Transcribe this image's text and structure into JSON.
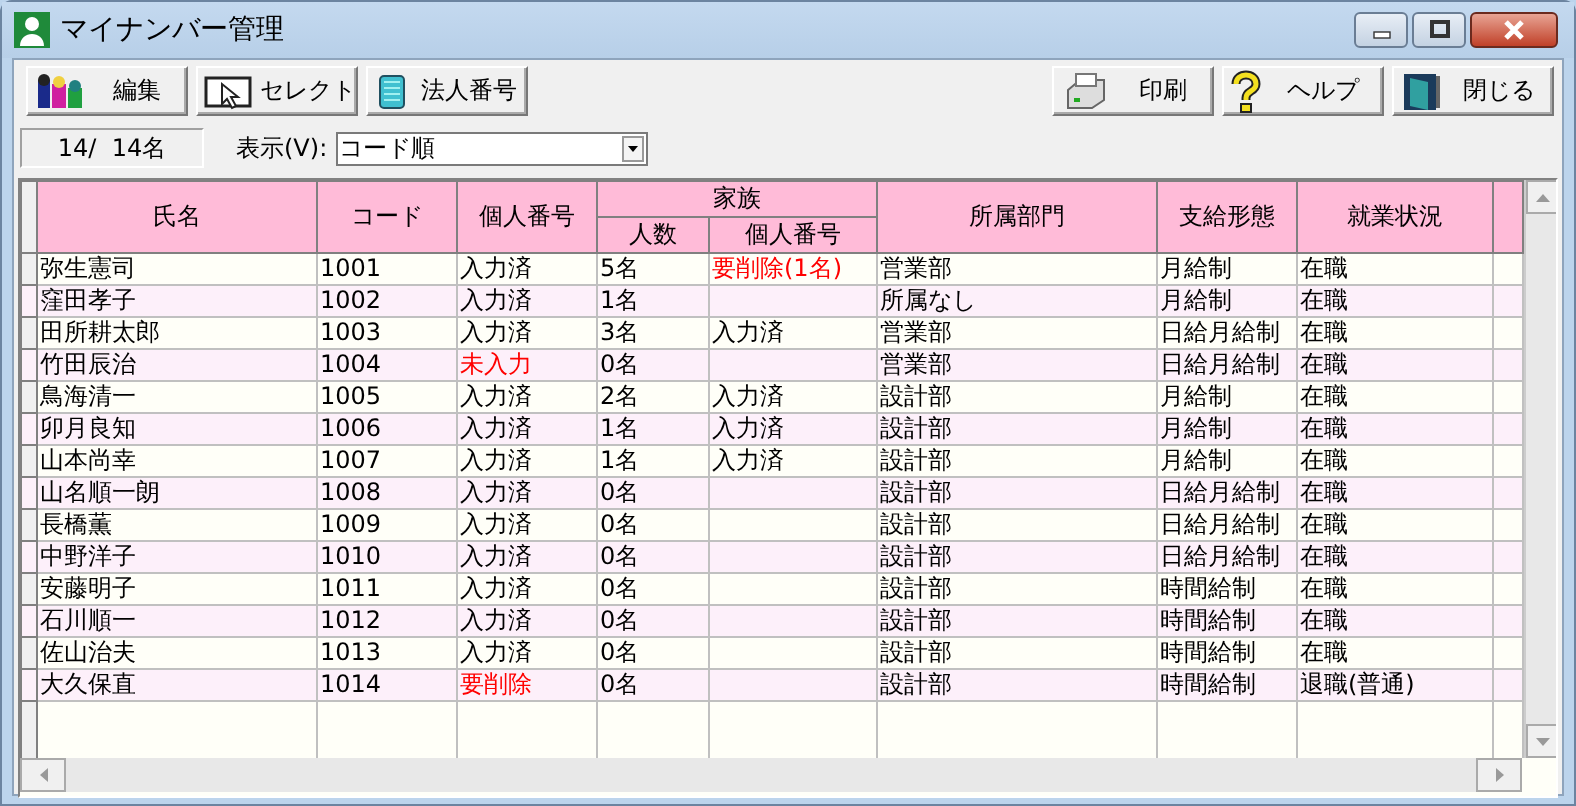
{
  "window": {
    "title": "マイナンバー管理"
  },
  "toolbar": {
    "left": [
      {
        "label": "編集"
      },
      {
        "label": "セレクト"
      },
      {
        "label": "法人番号"
      }
    ],
    "right": [
      {
        "label": "印刷"
      },
      {
        "label": "ヘルプ"
      },
      {
        "label": "閉じる"
      }
    ]
  },
  "status": {
    "count": "14/  14名",
    "view_label": "表示(V):",
    "view_value": "コード順"
  },
  "table": {
    "columns": [
      {
        "label": "氏名"
      },
      {
        "label": "コード"
      },
      {
        "label": "個人番号"
      },
      {
        "label": "家族",
        "children": [
          {
            "label": "人数"
          },
          {
            "label": "個人番号"
          }
        ]
      },
      {
        "label": "所属部門"
      },
      {
        "label": "支給形態"
      },
      {
        "label": "就業状況"
      }
    ],
    "rows": [
      {
        "name": "弥生憲司",
        "code": "1001",
        "my_number": {
          "text": "入力済",
          "alert": false
        },
        "family_count": "5名",
        "family_my_number": {
          "text": "要削除(1名)",
          "alert": true
        },
        "department": "営業部",
        "pay_type": "月給制",
        "employment": "在職"
      },
      {
        "name": "窪田孝子",
        "code": "1002",
        "my_number": {
          "text": "入力済",
          "alert": false
        },
        "family_count": "1名",
        "family_my_number": null,
        "department": "所属なし",
        "pay_type": "月給制",
        "employment": "在職"
      },
      {
        "name": "田所耕太郎",
        "code": "1003",
        "my_number": {
          "text": "入力済",
          "alert": false
        },
        "family_count": "3名",
        "family_my_number": {
          "text": "入力済",
          "alert": false
        },
        "department": "営業部",
        "pay_type": "日給月給制",
        "employment": "在職"
      },
      {
        "name": "竹田辰治",
        "code": "1004",
        "my_number": {
          "text": "未入力",
          "alert": true
        },
        "family_count": "0名",
        "family_my_number": null,
        "department": "営業部",
        "pay_type": "日給月給制",
        "employment": "在職"
      },
      {
        "name": "鳥海清一",
        "code": "1005",
        "my_number": {
          "text": "入力済",
          "alert": false
        },
        "family_count": "2名",
        "family_my_number": {
          "text": "入力済",
          "alert": false
        },
        "department": "設計部",
        "pay_type": "月給制",
        "employment": "在職"
      },
      {
        "name": "卯月良知",
        "code": "1006",
        "my_number": {
          "text": "入力済",
          "alert": false
        },
        "family_count": "1名",
        "family_my_number": {
          "text": "入力済",
          "alert": false
        },
        "department": "設計部",
        "pay_type": "月給制",
        "employment": "在職"
      },
      {
        "name": "山本尚幸",
        "code": "1007",
        "my_number": {
          "text": "入力済",
          "alert": false
        },
        "family_count": "1名",
        "family_my_number": {
          "text": "入力済",
          "alert": false
        },
        "department": "設計部",
        "pay_type": "月給制",
        "employment": "在職"
      },
      {
        "name": "山名順一朗",
        "code": "1008",
        "my_number": {
          "text": "入力済",
          "alert": false
        },
        "family_count": "0名",
        "family_my_number": null,
        "department": "設計部",
        "pay_type": "日給月給制",
        "employment": "在職"
      },
      {
        "name": "長橋薫",
        "code": "1009",
        "my_number": {
          "text": "入力済",
          "alert": false
        },
        "family_count": "0名",
        "family_my_number": null,
        "department": "設計部",
        "pay_type": "日給月給制",
        "employment": "在職"
      },
      {
        "name": "中野洋子",
        "code": "1010",
        "my_number": {
          "text": "入力済",
          "alert": false
        },
        "family_count": "0名",
        "family_my_number": null,
        "department": "設計部",
        "pay_type": "日給月給制",
        "employment": "在職"
      },
      {
        "name": "安藤明子",
        "code": "1011",
        "my_number": {
          "text": "入力済",
          "alert": false
        },
        "family_count": "0名",
        "family_my_number": null,
        "department": "設計部",
        "pay_type": "時間給制",
        "employment": "在職"
      },
      {
        "name": "石川順一",
        "code": "1012",
        "my_number": {
          "text": "入力済",
          "alert": false
        },
        "family_count": "0名",
        "family_my_number": null,
        "department": "設計部",
        "pay_type": "時間給制",
        "employment": "在職"
      },
      {
        "name": "佐山治夫",
        "code": "1013",
        "my_number": {
          "text": "入力済",
          "alert": false
        },
        "family_count": "0名",
        "family_my_number": null,
        "department": "設計部",
        "pay_type": "時間給制",
        "employment": "在職"
      },
      {
        "name": "大久保直",
        "code": "1014",
        "my_number": {
          "text": "要削除",
          "alert": true
        },
        "family_count": "0名",
        "family_my_number": null,
        "department": "設計部",
        "pay_type": "時間給制",
        "employment": "退職(普通)"
      }
    ]
  }
}
